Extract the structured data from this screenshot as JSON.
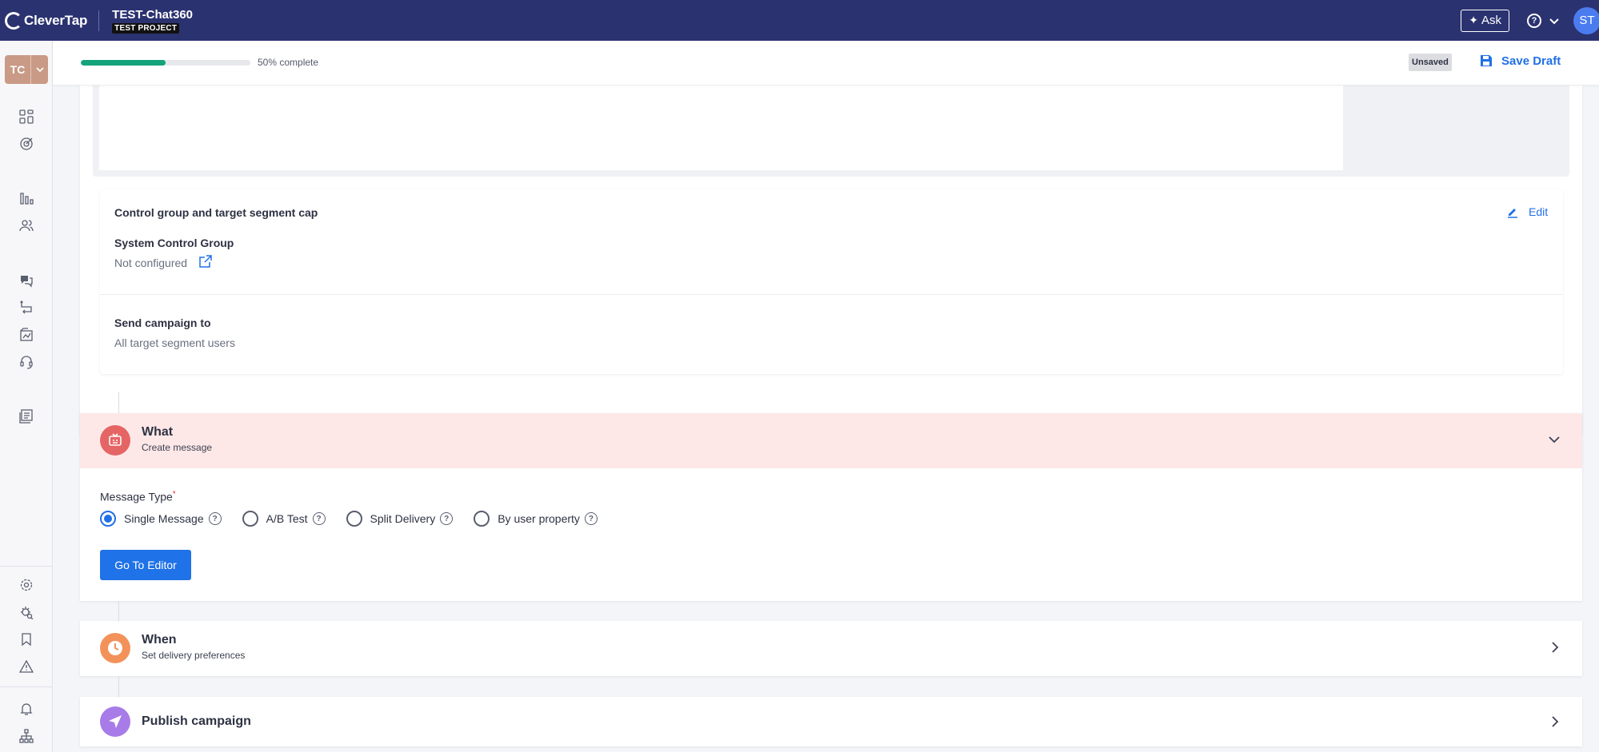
{
  "header": {
    "logo_text": "CleverTap",
    "project_name": "TEST-Chat360",
    "project_tag": "TEST PROJECT",
    "ask_label": "Ask",
    "avatar_initials": "ST"
  },
  "sidebar": {
    "account_initials": "TC",
    "icons": [
      "dashboard-icon",
      "target-icon",
      "analytics-icon",
      "users-icon",
      "messages-icon",
      "journeys-icon",
      "campaign-icon",
      "support-icon",
      "catalog-icon",
      "settings-icon",
      "debug-icon",
      "bookmark-icon",
      "alert-icon",
      "notification-icon",
      "org-chart-icon"
    ]
  },
  "progress": {
    "percent": 50,
    "label": "50% complete"
  },
  "status": {
    "unsaved_label": "Unsaved",
    "save_draft_label": "Save Draft"
  },
  "control_group": {
    "title": "Control group and target segment cap",
    "edit_label": "Edit",
    "system_control_label": "System Control Group",
    "system_control_value": "Not configured",
    "send_to_label": "Send campaign to",
    "send_to_value": "All target segment users"
  },
  "what": {
    "title": "What",
    "subtitle": "Create message",
    "message_type_label": "Message Type",
    "required_mark": "*",
    "options": [
      {
        "label": "Single Message",
        "selected": true
      },
      {
        "label": "A/B Test",
        "selected": false
      },
      {
        "label": "Split Delivery",
        "selected": false
      },
      {
        "label": "By user property",
        "selected": false
      }
    ],
    "editor_button": "Go To Editor"
  },
  "when": {
    "title": "When",
    "subtitle": "Set delivery preferences"
  },
  "publish": {
    "title": "Publish campaign"
  },
  "colors": {
    "topbar": "#2b3270",
    "accent": "#2170e6",
    "progress_fill": "#14a37a",
    "what_header_bg": "#fde8e7"
  }
}
